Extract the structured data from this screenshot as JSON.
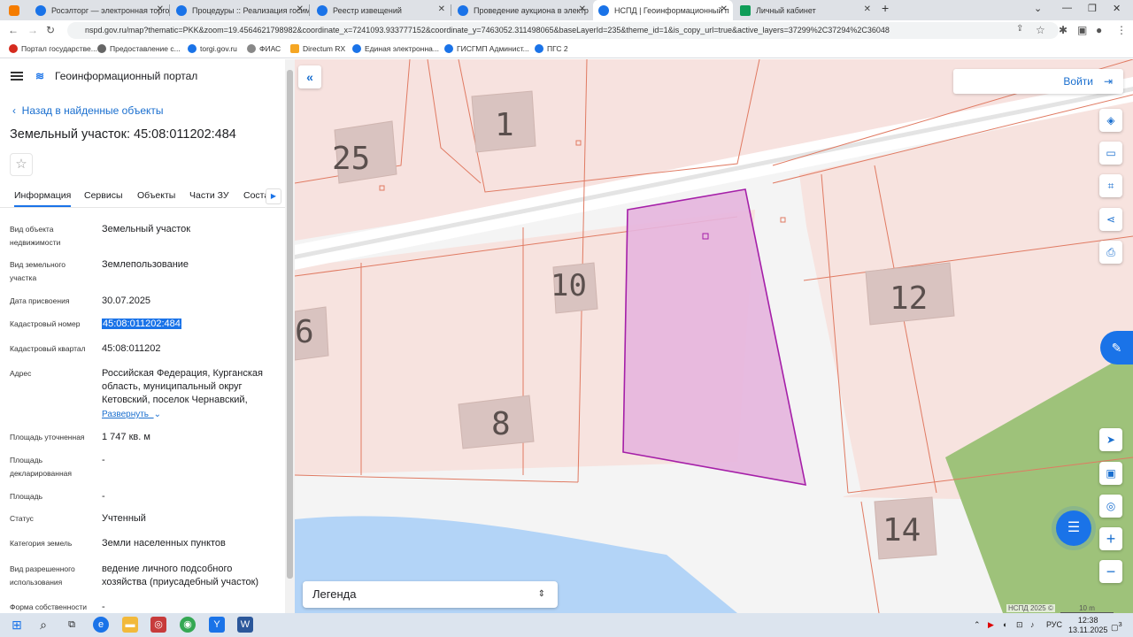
{
  "browser": {
    "tabs": [
      {
        "label": "Росэлторг — электронная торго"
      },
      {
        "label": "Процедуры :: Реализация госим"
      },
      {
        "label": "Реестр извещений"
      },
      {
        "label": "Проведение аукциона в электр"
      },
      {
        "label": "НСПД | Геоинформационный п"
      },
      {
        "label": "Личный кабинет"
      }
    ],
    "url": "nspd.gov.ru/map?thematic=PKK&zoom=19.4564621798982&coordinate_x=7241093.933777152&coordinate_y=7463052.311498065&baseLayerId=235&theme_id=1&is_copy_url=true&active_layers=37299%2C37294%2C36048",
    "bookmarks": [
      "Портал государстве...",
      "Предоставление с...",
      "torgi.gov.ru",
      "ФИАС",
      "Directum RX",
      "Единая электронна...",
      "ГИСГМП Админист...",
      "ПГС 2"
    ]
  },
  "panel": {
    "app_title": "Геоинформационный портал",
    "back_label": "Назад в найденные объекты",
    "object_title": "Земельный участок: 45:08:011202:484",
    "tabs": [
      "Информация",
      "Сервисы",
      "Объекты",
      "Части ЗУ",
      "Соста"
    ],
    "fields": [
      {
        "label": "Вид объекта недвижимости",
        "value": "Земельный участок"
      },
      {
        "label": "Вид земельного участка",
        "value": "Землепользование"
      },
      {
        "label": "Дата присвоения",
        "value": "30.07.2025"
      },
      {
        "label": "Кадастровый номер",
        "value": "45:08:011202:484"
      },
      {
        "label": "Кадастровый квартал",
        "value": "45:08:011202"
      },
      {
        "label": "Адрес",
        "value": "Российская Федерация, Курганская область, муниципальный округ Кетовский, поселок Чернавский,"
      },
      {
        "label": "Площадь уточненная",
        "value": "1 747 кв. м"
      },
      {
        "label": "Площадь декларированная",
        "value": "-"
      },
      {
        "label": "Площадь",
        "value": "-"
      },
      {
        "label": "Статус",
        "value": "Учтенный"
      },
      {
        "label": "Категория земель",
        "value": "Земли населенных пунктов"
      },
      {
        "label": "Вид разрешенного использования",
        "value": "ведение личного подсобного хозяйства (приусадебный участок)"
      },
      {
        "label": "Форма собственности",
        "value": "-"
      }
    ],
    "expand_label": "Развернуть"
  },
  "map": {
    "login_label": "Войти",
    "legend_label": "Легенда",
    "building_numbers": [
      "25",
      "1",
      "10",
      "12",
      "6",
      "8",
      "14"
    ],
    "attribution": "НСПД 2025 ©",
    "scale_label": "10 m"
  },
  "taskbar": {
    "language": "РУС",
    "time": "12:38",
    "date": "13.11.2025",
    "notifications": "3"
  }
}
